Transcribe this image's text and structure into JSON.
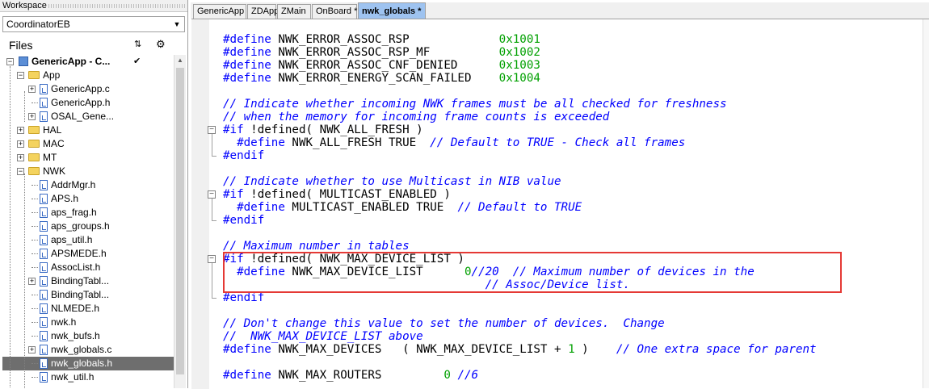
{
  "workspace": {
    "title": "Workspace",
    "config": "CoordinatorEB",
    "files_label": "Files",
    "sort_icon": "sort-icon",
    "settings_icon": "gear-icon",
    "project": {
      "label": "GenericApp - C...",
      "mark": "✔"
    },
    "tree": [
      {
        "label": "App",
        "type": "folder",
        "level": 1,
        "expander": "-"
      },
      {
        "label": "GenericApp.c",
        "type": "file",
        "level": 2,
        "expander": "+"
      },
      {
        "label": "GenericApp.h",
        "type": "file",
        "level": 2,
        "expander": ""
      },
      {
        "label": "OSAL_Gene...",
        "type": "file",
        "level": 2,
        "expander": "+"
      },
      {
        "label": "HAL",
        "type": "folder",
        "level": 1,
        "expander": "+"
      },
      {
        "label": "MAC",
        "type": "folder",
        "level": 1,
        "expander": "+"
      },
      {
        "label": "MT",
        "type": "folder",
        "level": 1,
        "expander": "+"
      },
      {
        "label": "NWK",
        "type": "folder",
        "level": 1,
        "expander": "-"
      },
      {
        "label": "AddrMgr.h",
        "type": "file",
        "level": 2,
        "expander": ""
      },
      {
        "label": "APS.h",
        "type": "file",
        "level": 2,
        "expander": ""
      },
      {
        "label": "aps_frag.h",
        "type": "file",
        "level": 2,
        "expander": ""
      },
      {
        "label": "aps_groups.h",
        "type": "file",
        "level": 2,
        "expander": ""
      },
      {
        "label": "aps_util.h",
        "type": "file",
        "level": 2,
        "expander": ""
      },
      {
        "label": "APSMEDE.h",
        "type": "file",
        "level": 2,
        "expander": ""
      },
      {
        "label": "AssocList.h",
        "type": "file",
        "level": 2,
        "expander": ""
      },
      {
        "label": "BindingTabl...",
        "type": "file",
        "level": 2,
        "expander": "+"
      },
      {
        "label": "BindingTabl...",
        "type": "file",
        "level": 2,
        "expander": ""
      },
      {
        "label": "NLMEDE.h",
        "type": "file",
        "level": 2,
        "expander": ""
      },
      {
        "label": "nwk.h",
        "type": "file",
        "level": 2,
        "expander": ""
      },
      {
        "label": "nwk_bufs.h",
        "type": "file",
        "level": 2,
        "expander": ""
      },
      {
        "label": "nwk_globals.c",
        "type": "file",
        "level": 2,
        "expander": "+"
      },
      {
        "label": "nwk_globals.h",
        "type": "file",
        "level": 2,
        "expander": "",
        "selected": true
      },
      {
        "label": "nwk_util.h",
        "type": "file",
        "level": 2,
        "expander": ""
      }
    ]
  },
  "tabs": [
    {
      "label": "GenericApp",
      "active": false
    },
    {
      "label": "ZDApp",
      "active": false
    },
    {
      "label": "ZMain",
      "active": false
    },
    {
      "label": "OnBoard *",
      "active": false
    },
    {
      "label": "nwk_globals *",
      "active": true
    }
  ],
  "code": [
    {
      "row": 0,
      "segs": [
        [
          "kw",
          "#define"
        ],
        [
          "t",
          " NWK_ERROR_ASSOC_RSP             "
        ],
        [
          "num",
          "0x1001"
        ]
      ]
    },
    {
      "row": 1,
      "segs": [
        [
          "kw",
          "#define"
        ],
        [
          "t",
          " NWK_ERROR_ASSOC_RSP_MF          "
        ],
        [
          "num",
          "0x1002"
        ]
      ]
    },
    {
      "row": 2,
      "segs": [
        [
          "kw",
          "#define"
        ],
        [
          "t",
          " NWK_ERROR_ASSOC_CNF_DENIED      "
        ],
        [
          "num",
          "0x1003"
        ]
      ]
    },
    {
      "row": 3,
      "segs": [
        [
          "kw",
          "#define"
        ],
        [
          "t",
          " NWK_ERROR_ENERGY_SCAN_FAILED    "
        ],
        [
          "num",
          "0x1004"
        ]
      ]
    },
    {
      "row": 5,
      "segs": [
        [
          "cm",
          "// Indicate whether incoming NWK frames must be all checked for freshness"
        ]
      ]
    },
    {
      "row": 6,
      "segs": [
        [
          "cm",
          "// when the memory for incoming frame counts is exceeded"
        ]
      ]
    },
    {
      "row": 7,
      "segs": [
        [
          "kw",
          "#if"
        ],
        [
          "t",
          " !defined( NWK_ALL_FRESH )"
        ]
      ],
      "fold": "open"
    },
    {
      "row": 8,
      "segs": [
        [
          "t",
          "  "
        ],
        [
          "kw",
          "#define"
        ],
        [
          "t",
          " NWK_ALL_FRESH TRUE  "
        ],
        [
          "cm",
          "// Default to TRUE - Check all frames"
        ]
      ]
    },
    {
      "row": 9,
      "segs": [
        [
          "kw",
          "#endif"
        ]
      ],
      "fold": "end"
    },
    {
      "row": 11,
      "segs": [
        [
          "cm",
          "// Indicate whether to use Multicast in NIB value"
        ]
      ]
    },
    {
      "row": 12,
      "segs": [
        [
          "kw",
          "#if"
        ],
        [
          "t",
          " !defined( MULTICAST_ENABLED )"
        ]
      ],
      "fold": "open"
    },
    {
      "row": 13,
      "segs": [
        [
          "t",
          "  "
        ],
        [
          "kw",
          "#define"
        ],
        [
          "t",
          " MULTICAST_ENABLED TRUE  "
        ],
        [
          "cm",
          "// Default to TRUE"
        ]
      ]
    },
    {
      "row": 14,
      "segs": [
        [
          "kw",
          "#endif"
        ]
      ],
      "fold": "end"
    },
    {
      "row": 16,
      "segs": [
        [
          "cm",
          "// Maximum number in tables"
        ]
      ]
    },
    {
      "row": 17,
      "segs": [
        [
          "kw",
          "#if"
        ],
        [
          "t",
          " !defined( NWK_MAX_DEVICE_LIST )"
        ]
      ],
      "fold": "open"
    },
    {
      "row": 18,
      "segs": [
        [
          "t",
          "  "
        ],
        [
          "kw",
          "#define"
        ],
        [
          "t",
          " NWK_MAX_DEVICE_LIST      "
        ],
        [
          "num",
          "0"
        ],
        [
          "cm",
          "//20  // Maximum number of devices in the"
        ]
      ]
    },
    {
      "row": 19,
      "segs": [
        [
          "t",
          "                                      "
        ],
        [
          "cm",
          "// Assoc/Device list."
        ]
      ]
    },
    {
      "row": 20,
      "segs": [
        [
          "kw",
          "#endif"
        ]
      ],
      "fold": "end"
    },
    {
      "row": 22,
      "segs": [
        [
          "cm",
          "// Don't change this value to set the number of devices.  Change"
        ]
      ]
    },
    {
      "row": 23,
      "segs": [
        [
          "cm",
          "//  NWK_MAX_DEVICE_LIST above"
        ]
      ]
    },
    {
      "row": 24,
      "segs": [
        [
          "kw",
          "#define"
        ],
        [
          "t",
          " NWK_MAX_DEVICES   ( NWK_MAX_DEVICE_LIST + "
        ],
        [
          "num",
          "1"
        ],
        [
          "t",
          " )    "
        ],
        [
          "cm",
          "// One extra space for parent"
        ]
      ]
    },
    {
      "row": 26,
      "segs": [
        [
          "kw",
          "#define"
        ],
        [
          "t",
          " NWK_MAX_ROUTERS         "
        ],
        [
          "num",
          "0"
        ],
        [
          "t",
          " "
        ],
        [
          "cm",
          "//6"
        ]
      ]
    }
  ],
  "colors": {
    "keyword": "#0000ff",
    "comment": "#0000ff",
    "number": "#00a000",
    "highlight": "#e53935",
    "active_tab": "#9ec3f0"
  }
}
